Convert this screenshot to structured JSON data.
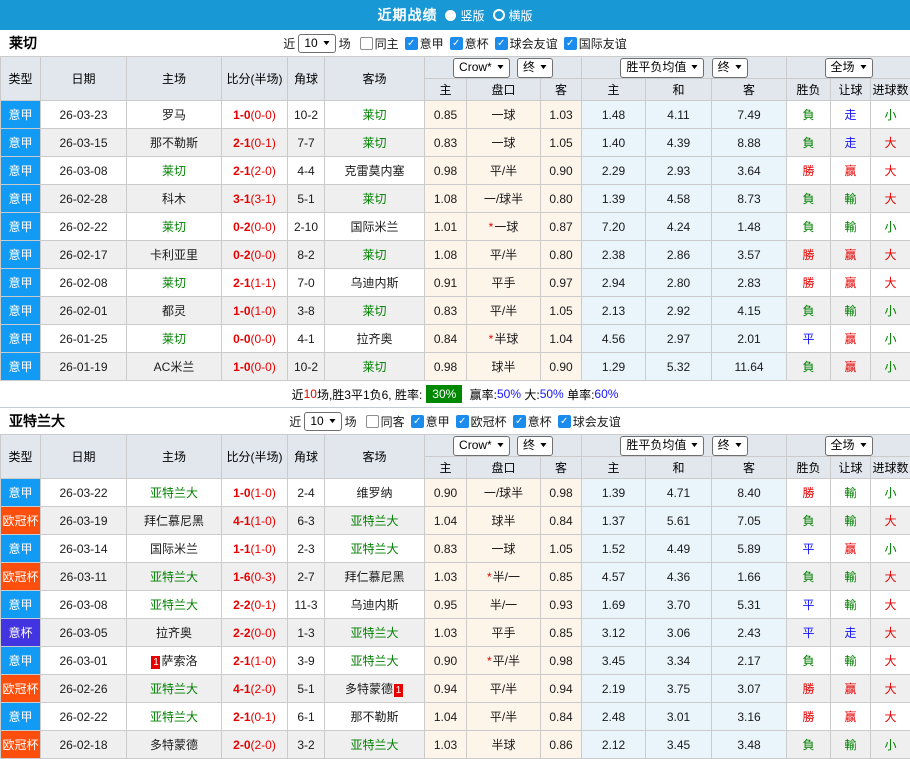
{
  "titlebar": {
    "title": "近期战绩",
    "orientations": [
      {
        "label": "竖版",
        "selected": true
      },
      {
        "label": "横版",
        "selected": false
      }
    ]
  },
  "colors": {
    "titlebar_blue": "#1898d5",
    "badge_green": "#008800",
    "text_red": "#e60000",
    "text_green": "#008000",
    "text_blue": "#1414ff",
    "league": {
      "意甲": "#129bf5",
      "欧冠杯": "#fc4e0c",
      "意杯": "#4334e1"
    }
  },
  "table_header": {
    "types": "类型",
    "date": "日期",
    "home": "主场",
    "score": "比分(半场)",
    "corner": "角球",
    "away": "客场",
    "odds_dropdown": "Crow*",
    "odds_final": "终",
    "odds_cols": [
      "主",
      "盘口",
      "客"
    ],
    "avg_dropdown": "胜平负均值",
    "avg_final": "终",
    "avg_cols": [
      "主",
      "和",
      "客"
    ],
    "result_dropdown": "全场",
    "result_cols": [
      "胜负",
      "让球",
      "进球数"
    ]
  },
  "sections": [
    {
      "team": "莱切",
      "filters": {
        "recent_prefix": "近",
        "recent_value": "10",
        "recent_suffix": "场",
        "checkboxes": [
          {
            "label": "同主",
            "checked": false
          },
          {
            "label": "意甲",
            "checked": true
          },
          {
            "label": "意杯",
            "checked": true
          },
          {
            "label": "球会友谊",
            "checked": true
          },
          {
            "label": "国际友谊",
            "checked": true
          }
        ]
      },
      "rows": [
        {
          "league": "意甲",
          "date": "26-03-23",
          "home": "罗马",
          "home_focus": false,
          "score": "1-0",
          "half": "(0-0)",
          "corner": "10-2",
          "away": "莱切",
          "away_focus": true,
          "odds_home": "0.85",
          "handicap": "一球",
          "odds_away": "1.03",
          "avg_win": "1.48",
          "avg_draw": "4.11",
          "avg_lose": "7.49",
          "result": "負",
          "result_c": "g",
          "handicap_result": "走",
          "handicap_result_c": "b",
          "goals": "小",
          "goals_c": "g"
        },
        {
          "league": "意甲",
          "date": "26-03-15",
          "home": "那不勒斯",
          "home_focus": false,
          "score": "2-1",
          "half": "(0-1)",
          "corner": "7-7",
          "away": "莱切",
          "away_focus": true,
          "odds_home": "0.83",
          "handicap": "一球",
          "odds_away": "1.05",
          "avg_win": "1.40",
          "avg_draw": "4.39",
          "avg_lose": "8.88",
          "result": "負",
          "result_c": "g",
          "handicap_result": "走",
          "handicap_result_c": "b",
          "goals": "大",
          "goals_c": "r"
        },
        {
          "league": "意甲",
          "date": "26-03-08",
          "home": "莱切",
          "home_focus": true,
          "score": "2-1",
          "half": "(2-0)",
          "corner": "4-4",
          "away": "克雷莫内塞",
          "away_focus": false,
          "odds_home": "0.98",
          "handicap": "平/半",
          "odds_away": "0.90",
          "avg_win": "2.29",
          "avg_draw": "2.93",
          "avg_lose": "3.64",
          "result": "勝",
          "result_c": "r",
          "handicap_result": "赢",
          "handicap_result_c": "r",
          "goals": "大",
          "goals_c": "r"
        },
        {
          "league": "意甲",
          "date": "26-02-28",
          "home": "科木",
          "home_focus": false,
          "score": "3-1",
          "half": "(3-1)",
          "corner": "5-1",
          "away": "莱切",
          "away_focus": true,
          "odds_home": "1.08",
          "handicap": "一/球半",
          "odds_away": "0.80",
          "avg_win": "1.39",
          "avg_draw": "4.58",
          "avg_lose": "8.73",
          "result": "負",
          "result_c": "g",
          "handicap_result": "輸",
          "handicap_result_c": "g",
          "goals": "大",
          "goals_c": "r"
        },
        {
          "league": "意甲",
          "date": "26-02-22",
          "home": "莱切",
          "home_focus": true,
          "score": "0-2",
          "half": "(0-0)",
          "corner": "2-10",
          "away": "国际米兰",
          "away_focus": false,
          "odds_home": "1.01",
          "handicap_star": "*",
          "handicap": "一球",
          "odds_away": "0.87",
          "avg_win": "7.20",
          "avg_draw": "4.24",
          "avg_lose": "1.48",
          "result": "負",
          "result_c": "g",
          "handicap_result": "輸",
          "handicap_result_c": "g",
          "goals": "小",
          "goals_c": "g"
        },
        {
          "league": "意甲",
          "date": "26-02-17",
          "home": "卡利亚里",
          "home_focus": false,
          "score": "0-2",
          "half": "(0-0)",
          "corner": "8-2",
          "away": "莱切",
          "away_focus": true,
          "odds_home": "1.08",
          "handicap": "平/半",
          "odds_away": "0.80",
          "avg_win": "2.38",
          "avg_draw": "2.86",
          "avg_lose": "3.57",
          "result": "勝",
          "result_c": "r",
          "handicap_result": "赢",
          "handicap_result_c": "r",
          "goals": "大",
          "goals_c": "r"
        },
        {
          "league": "意甲",
          "date": "26-02-08",
          "home": "莱切",
          "home_focus": true,
          "score": "2-1",
          "half": "(1-1)",
          "corner": "7-0",
          "away": "乌迪内斯",
          "away_focus": false,
          "odds_home": "0.91",
          "handicap": "平手",
          "odds_away": "0.97",
          "avg_win": "2.94",
          "avg_draw": "2.80",
          "avg_lose": "2.83",
          "result": "勝",
          "result_c": "r",
          "handicap_result": "赢",
          "handicap_result_c": "r",
          "goals": "大",
          "goals_c": "r"
        },
        {
          "league": "意甲",
          "date": "26-02-01",
          "home": "都灵",
          "home_focus": false,
          "score": "1-0",
          "half": "(1-0)",
          "corner": "3-8",
          "away": "莱切",
          "away_focus": true,
          "odds_home": "0.83",
          "handicap": "平/半",
          "odds_away": "1.05",
          "avg_win": "2.13",
          "avg_draw": "2.92",
          "avg_lose": "4.15",
          "result": "負",
          "result_c": "g",
          "handicap_result": "輸",
          "handicap_result_c": "g",
          "goals": "小",
          "goals_c": "g"
        },
        {
          "league": "意甲",
          "date": "26-01-25",
          "home": "莱切",
          "home_focus": true,
          "score": "0-0",
          "half": "(0-0)",
          "corner": "4-1",
          "away": "拉齐奥",
          "away_focus": false,
          "odds_home": "0.84",
          "handicap_star": "*",
          "handicap": "半球",
          "odds_away": "1.04",
          "avg_win": "4.56",
          "avg_draw": "2.97",
          "avg_lose": "2.01",
          "result": "平",
          "result_c": "b",
          "handicap_result": "赢",
          "handicap_result_c": "r",
          "goals": "小",
          "goals_c": "g"
        },
        {
          "league": "意甲",
          "date": "26-01-19",
          "home": "AC米兰",
          "home_focus": false,
          "score": "1-0",
          "half": "(0-0)",
          "corner": "10-2",
          "away": "莱切",
          "away_focus": true,
          "odds_home": "0.98",
          "handicap": "球半",
          "odds_away": "0.90",
          "avg_win": "1.29",
          "avg_draw": "5.32",
          "avg_lose": "11.64",
          "result": "負",
          "result_c": "g",
          "handicap_result": "赢",
          "handicap_result_c": "r",
          "goals": "小",
          "goals_c": "g"
        }
      ],
      "summary": {
        "parts": [
          {
            "t": "近",
            "c": "k"
          },
          {
            "t": "10",
            "c": "r"
          },
          {
            "t": "场,胜3平1负6, 胜率:",
            "c": "k"
          },
          {
            "t": "30%",
            "c": "badge"
          },
          {
            "t": " 赢率:",
            "c": "k"
          },
          {
            "t": "50%",
            "c": "b"
          },
          {
            "t": " 大:",
            "c": "k"
          },
          {
            "t": "50%",
            "c": "b"
          },
          {
            "t": " 单率:",
            "c": "k"
          },
          {
            "t": "60%",
            "c": "b"
          }
        ]
      }
    },
    {
      "team": "亚特兰大",
      "filters": {
        "recent_prefix": "近",
        "recent_value": "10",
        "recent_suffix": "场",
        "checkboxes": [
          {
            "label": "同客",
            "checked": false
          },
          {
            "label": "意甲",
            "checked": true
          },
          {
            "label": "欧冠杯",
            "checked": true
          },
          {
            "label": "意杯",
            "checked": true
          },
          {
            "label": "球会友谊",
            "checked": true
          }
        ]
      },
      "rows": [
        {
          "league": "意甲",
          "date": "26-03-22",
          "home": "亚特兰大",
          "home_focus": true,
          "score": "1-0",
          "half": "(1-0)",
          "corner": "2-4",
          "away": "维罗纳",
          "away_focus": false,
          "odds_home": "0.90",
          "handicap": "一/球半",
          "odds_away": "0.98",
          "avg_win": "1.39",
          "avg_draw": "4.71",
          "avg_lose": "8.40",
          "result": "勝",
          "result_c": "r",
          "handicap_result": "輸",
          "handicap_result_c": "g",
          "goals": "小",
          "goals_c": "g"
        },
        {
          "league": "欧冠杯",
          "date": "26-03-19",
          "home": "拜仁慕尼黑",
          "home_focus": false,
          "score": "4-1",
          "half": "(1-0)",
          "corner": "6-3",
          "away": "亚特兰大",
          "away_focus": true,
          "odds_home": "1.04",
          "handicap": "球半",
          "odds_away": "0.84",
          "avg_win": "1.37",
          "avg_draw": "5.61",
          "avg_lose": "7.05",
          "result": "負",
          "result_c": "g",
          "handicap_result": "輸",
          "handicap_result_c": "g",
          "goals": "大",
          "goals_c": "r"
        },
        {
          "league": "意甲",
          "date": "26-03-14",
          "home": "国际米兰",
          "home_focus": false,
          "score": "1-1",
          "half": "(1-0)",
          "corner": "2-3",
          "away": "亚特兰大",
          "away_focus": true,
          "odds_home": "0.83",
          "handicap": "一球",
          "odds_away": "1.05",
          "avg_win": "1.52",
          "avg_draw": "4.49",
          "avg_lose": "5.89",
          "result": "平",
          "result_c": "b",
          "handicap_result": "赢",
          "handicap_result_c": "r",
          "goals": "小",
          "goals_c": "g"
        },
        {
          "league": "欧冠杯",
          "date": "26-03-11",
          "home": "亚特兰大",
          "home_focus": true,
          "score": "1-6",
          "half": "(0-3)",
          "corner": "2-7",
          "away": "拜仁慕尼黑",
          "away_focus": false,
          "odds_home": "1.03",
          "handicap_star": "*",
          "handicap": "半/一",
          "odds_away": "0.85",
          "avg_win": "4.57",
          "avg_draw": "4.36",
          "avg_lose": "1.66",
          "result": "負",
          "result_c": "g",
          "handicap_result": "輸",
          "handicap_result_c": "g",
          "goals": "大",
          "goals_c": "r"
        },
        {
          "league": "意甲",
          "date": "26-03-08",
          "home": "亚特兰大",
          "home_focus": true,
          "score": "2-2",
          "half": "(0-1)",
          "corner": "11-3",
          "away": "乌迪内斯",
          "away_focus": false,
          "odds_home": "0.95",
          "handicap": "半/一",
          "odds_away": "0.93",
          "avg_win": "1.69",
          "avg_draw": "3.70",
          "avg_lose": "5.31",
          "result": "平",
          "result_c": "b",
          "handicap_result": "輸",
          "handicap_result_c": "g",
          "goals": "大",
          "goals_c": "r"
        },
        {
          "league": "意杯",
          "date": "26-03-05",
          "home": "拉齐奥",
          "home_focus": false,
          "score": "2-2",
          "half": "(0-0)",
          "corner": "1-3",
          "away": "亚特兰大",
          "away_focus": true,
          "odds_home": "1.03",
          "handicap": "平手",
          "odds_away": "0.85",
          "avg_win": "3.12",
          "avg_draw": "3.06",
          "avg_lose": "2.43",
          "result": "平",
          "result_c": "b",
          "handicap_result": "走",
          "handicap_result_c": "b",
          "goals": "大",
          "goals_c": "r"
        },
        {
          "league": "意甲",
          "date": "26-03-01",
          "home": "萨索洛",
          "home_focus": false,
          "home_card": "1",
          "score": "2-1",
          "half": "(1-0)",
          "corner": "3-9",
          "away": "亚特兰大",
          "away_focus": true,
          "odds_home": "0.90",
          "handicap_star": "*",
          "handicap": "平/半",
          "odds_away": "0.98",
          "avg_win": "3.45",
          "avg_draw": "3.34",
          "avg_lose": "2.17",
          "result": "負",
          "result_c": "g",
          "handicap_result": "輸",
          "handicap_result_c": "g",
          "goals": "大",
          "goals_c": "r"
        },
        {
          "league": "欧冠杯",
          "date": "26-02-26",
          "home": "亚特兰大",
          "home_focus": true,
          "score": "4-1",
          "half": "(2-0)",
          "corner": "5-1",
          "away": "多特蒙德",
          "away_focus": false,
          "away_card": "1",
          "odds_home": "0.94",
          "handicap": "平/半",
          "odds_away": "0.94",
          "avg_win": "2.19",
          "avg_draw": "3.75",
          "avg_lose": "3.07",
          "result": "勝",
          "result_c": "r",
          "handicap_result": "赢",
          "handicap_result_c": "r",
          "goals": "大",
          "goals_c": "r"
        },
        {
          "league": "意甲",
          "date": "26-02-22",
          "home": "亚特兰大",
          "home_focus": true,
          "score": "2-1",
          "half": "(0-1)",
          "corner": "6-1",
          "away": "那不勒斯",
          "away_focus": false,
          "odds_home": "1.04",
          "handicap": "平/半",
          "odds_away": "0.84",
          "avg_win": "2.48",
          "avg_draw": "3.01",
          "avg_lose": "3.16",
          "result": "勝",
          "result_c": "r",
          "handicap_result": "赢",
          "handicap_result_c": "r",
          "goals": "大",
          "goals_c": "r"
        },
        {
          "league": "欧冠杯",
          "date": "26-02-18",
          "home": "多特蒙德",
          "home_focus": false,
          "score": "2-0",
          "half": "(2-0)",
          "corner": "3-2",
          "away": "亚特兰大",
          "away_focus": true,
          "odds_home": "1.03",
          "handicap": "半球",
          "odds_away": "0.86",
          "avg_win": "2.12",
          "avg_draw": "3.45",
          "avg_lose": "3.48",
          "result": "負",
          "result_c": "g",
          "handicap_result": "輸",
          "handicap_result_c": "g",
          "goals": "小",
          "goals_c": "g"
        }
      ],
      "summary": null
    }
  ]
}
